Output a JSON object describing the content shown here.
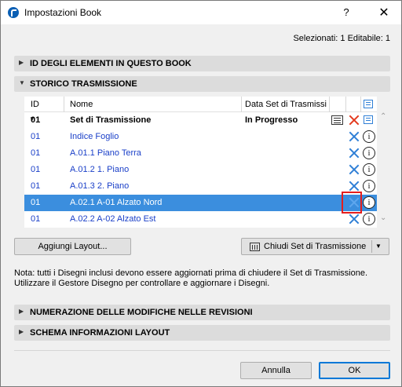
{
  "window": {
    "title": "Impostazioni Book",
    "help": "?",
    "close": "✕"
  },
  "selection_info": "Selezionati: 1 Editabile: 1",
  "sections": {
    "ids": "ID DEGLI ELEMENTI IN QUESTO BOOK",
    "history": "STORICO TRASMISSIONE",
    "numbering": "NUMERAZIONE DELLE MODIFICHE NELLE REVISIONI",
    "layout_schema": "SCHEMA INFORMAZIONI LAYOUT"
  },
  "table": {
    "headers": {
      "id": "ID",
      "name": "Nome",
      "date": "Data Set di Trasmissi"
    },
    "group": {
      "id": "01",
      "name": "Set di Trasmissione",
      "status": "In Progresso"
    },
    "rows": [
      {
        "id": "01",
        "name": "Indice Foglio"
      },
      {
        "id": "01",
        "name": "A.01.1 Piano Terra"
      },
      {
        "id": "01",
        "name": "A.01.2 1. Piano"
      },
      {
        "id": "01",
        "name": "A.01.3 2. Piano"
      },
      {
        "id": "01",
        "name": "A.02.1 A-01 Alzato Nord"
      },
      {
        "id": "01",
        "name": "A.02.2 A-02 Alzato Est"
      }
    ]
  },
  "buttons": {
    "add_layout": "Aggiungi Layout...",
    "close_set": "Chiudi Set di Trasmissione",
    "cancel": "Annulla",
    "ok": "OK"
  },
  "note": "Nota: tutti i Disegni inclusi devono essere aggiornati prima di chiudere il Set di Trasmissione. Utilizzare il Gestore Disegno per controllare e aggiornare i Disegni.",
  "icons": {
    "expand": "▶",
    "collapse": "▼",
    "info": "i",
    "scroll_up": "⌃",
    "scroll_down": "⌄",
    "dropdown": "▼"
  },
  "colors": {
    "selected_row": "#3b8ede",
    "link_text": "#1a3fc8",
    "highlight": "#e41d1d"
  }
}
